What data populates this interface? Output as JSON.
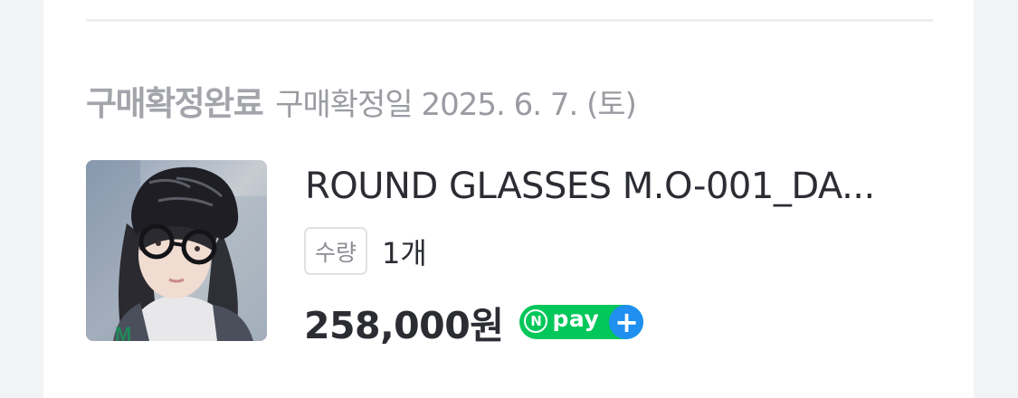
{
  "order": {
    "status": "구매확정완료",
    "confirm_date": "구매확정일 2025. 6. 7. (토)"
  },
  "product": {
    "name": "ROUND GLASSES M.O-001_DA...",
    "quantity_label": "수량",
    "quantity_value": "1개",
    "price": "258,000원",
    "thumbnail_icon": "product-photo"
  },
  "payment": {
    "badge_n": "N",
    "badge_text": "pay",
    "badge_plus": "+",
    "colors": {
      "npay_green": "#03c75a",
      "npay_plus_blue": "#1f8ff0"
    }
  }
}
